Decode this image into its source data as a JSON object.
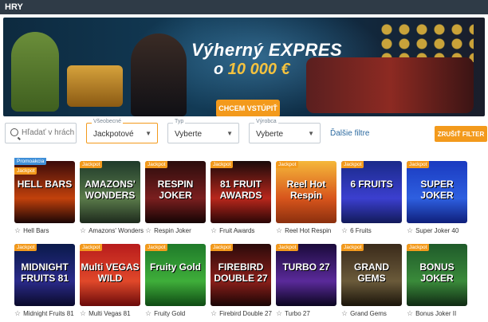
{
  "header": {
    "title": "HRY"
  },
  "banner": {
    "title": "Výherný EXPRES",
    "amount_prefix": "o ",
    "amount_value": "10 000 €",
    "cta": "CHCEM VSTÚPIŤ",
    "slides": 3,
    "active_slide": 1
  },
  "filters": {
    "search_placeholder": "Hľadať v hrách",
    "general": {
      "label": "Všeobecné",
      "value": "Jackpotové"
    },
    "type": {
      "label": "Typ",
      "value": "Vyberte"
    },
    "maker": {
      "label": "Výrobca",
      "value": "Vyberte"
    },
    "more": "Ďalšie filtre",
    "cancel": "ZRUŠIŤ FILTER"
  },
  "colors": {
    "accent": "#f39a1c",
    "header": "#2f3b47",
    "link": "#2c6aa0",
    "promo": "#3f8fd8"
  },
  "games": [
    {
      "title": "Hell Bars",
      "art": "HELL BARS",
      "badge": "Jackpot",
      "promo": "Promoakcia",
      "bg": "linear-gradient(#3a0a0a,#c2410c 60%,#1a0505)"
    },
    {
      "title": "Amazons' Wonders",
      "art": "AMAZONS' WONDERS",
      "badge": "Jackpot",
      "bg": "linear-gradient(#1f3a2a,#5a7a4a 60%,#1d2a1d)"
    },
    {
      "title": "Respin Joker",
      "art": "RESPIN JOKER",
      "badge": "Jackpot",
      "bg": "linear-gradient(#2a0c0c,#7a1f1f 60%,#140404)"
    },
    {
      "title": "Fruit Awards",
      "art": "81 FRUIT AWARDS",
      "badge": "Jackpot",
      "bg": "linear-gradient(#1a0a0a,#b8271c 60%,#2a0606)"
    },
    {
      "title": "Reel Hot Respin",
      "art": "Reel Hot Respin",
      "badge": "Jackpot",
      "bg": "linear-gradient(#f5b83a,#d8551c 60%,#8a2f0e)"
    },
    {
      "title": "6 Fruits",
      "art": "6 FRUITS",
      "badge": "Jackpot",
      "bg": "linear-gradient(#1a2a8a,#3b3fcf 60%,#121a5a)"
    },
    {
      "title": "Super Joker 40",
      "art": "SUPER JOKER",
      "badge": "Jackpot",
      "bg": "linear-gradient(#1a3ac0,#2e5fe0 60%,#0f1f7a)"
    },
    {
      "title": "Midnight Fruits 81",
      "art": "MIDNIGHT FRUITS 81",
      "badge": "Jackpot",
      "bg": "linear-gradient(#0a1a4a,#2a2a8a 60%,#0a0a2a)"
    },
    {
      "title": "Multi Vegas 81",
      "art": "Multi VEGAS WILD",
      "badge": "Jackpot",
      "bg": "linear-gradient(#b81c1c,#e0482a 60%,#6a0a0a)"
    },
    {
      "title": "Fruity Gold",
      "art": "Fruity Gold",
      "badge": "Jackpot",
      "bg": "linear-gradient(#1f7a2a,#3fae3a 60%,#0f4a14)"
    },
    {
      "title": "Firebird Double 27",
      "art": "FIREBIRD DOUBLE 27",
      "badge": "Jackpot",
      "bg": "linear-gradient(#2a0a0a,#8a1f1a 60%,#1a0505)"
    },
    {
      "title": "Turbo 27",
      "art": "TURBO 27",
      "badge": "Jackpot",
      "bg": "linear-gradient(#1a0a3a,#5a2a9a 60%,#0a051f)"
    },
    {
      "title": "Grand Gems",
      "art": "GRAND GEMS",
      "badge": "Jackpot",
      "bg": "linear-gradient(#3a2a1a,#6a5a3a 60%,#1a140a)"
    },
    {
      "title": "Bonus Joker II",
      "art": "BONUS JOKER",
      "badge": "Jackpot",
      "bg": "linear-gradient(#1f5a2a,#3a8a3a 60%,#102a14)"
    }
  ]
}
